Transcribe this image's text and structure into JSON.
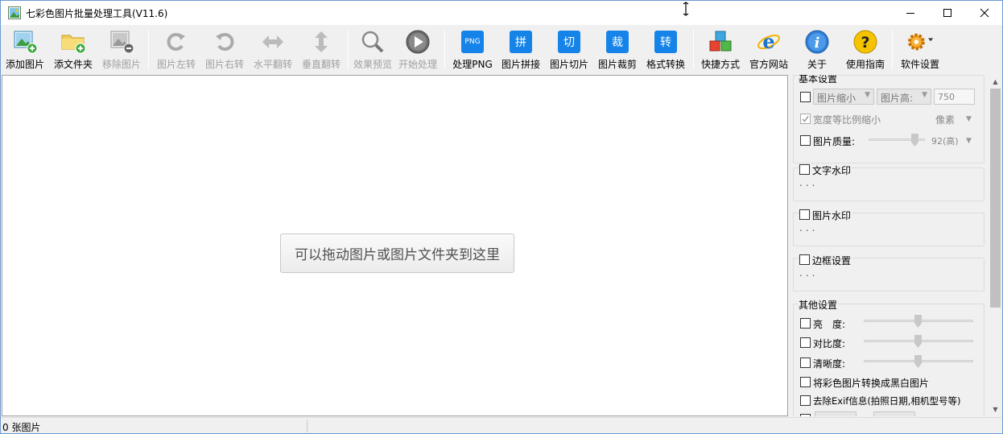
{
  "window": {
    "title": "七彩色图片批量处理工具(V11.6)"
  },
  "toolbar": {
    "items": [
      {
        "label": "添加图片",
        "icon": "add-image-icon",
        "enabled": true
      },
      {
        "label": "添文件夹",
        "icon": "add-folder-icon",
        "enabled": true
      },
      {
        "label": "移除图片",
        "icon": "remove-image-icon",
        "enabled": false
      },
      {
        "label": "图片左转",
        "icon": "rotate-left-icon",
        "enabled": false
      },
      {
        "label": "图片右转",
        "icon": "rotate-right-icon",
        "enabled": false
      },
      {
        "label": "水平翻转",
        "icon": "flip-horizontal-icon",
        "enabled": false
      },
      {
        "label": "垂直翻转",
        "icon": "flip-vertical-icon",
        "enabled": false
      },
      {
        "label": "效果预览",
        "icon": "preview-magnifier-icon",
        "enabled": false
      },
      {
        "label": "开始处理",
        "icon": "start-play-icon",
        "enabled": false
      },
      {
        "label": "处理PNG",
        "icon": "png-icon",
        "icon_text": "PNG",
        "enabled": true
      },
      {
        "label": "图片拼接",
        "icon": "stitch-icon",
        "icon_text": "拼",
        "enabled": true
      },
      {
        "label": "图片切片",
        "icon": "slice-icon",
        "icon_text": "切",
        "enabled": true
      },
      {
        "label": "图片裁剪",
        "icon": "crop-icon",
        "icon_text": "裁",
        "enabled": true
      },
      {
        "label": "格式转换",
        "icon": "convert-icon",
        "icon_text": "转",
        "enabled": true
      },
      {
        "label": "快捷方式",
        "icon": "shortcut-cubes-icon",
        "enabled": true
      },
      {
        "label": "官方网站",
        "icon": "ie-browser-icon",
        "enabled": true
      },
      {
        "label": "关于",
        "icon": "info-icon",
        "enabled": true
      },
      {
        "label": "使用指南",
        "icon": "help-icon",
        "enabled": true
      },
      {
        "label": "软件设置",
        "icon": "settings-gear-icon",
        "enabled": true
      }
    ]
  },
  "main": {
    "drop_hint": "可以拖动图片或图片文件夹到这里"
  },
  "panel": {
    "basic": {
      "title": "基本设置",
      "resize_mode": "图片缩小",
      "dimension": "图片高:",
      "dimension_value": "750",
      "keep_ratio": "宽度等比例缩小",
      "unit": "像素",
      "quality_label": "图片质量:",
      "quality_value": "92(高)"
    },
    "text_watermark": {
      "title": "文字水印",
      "dots": "..."
    },
    "image_watermark": {
      "title": "图片水印",
      "dots": "..."
    },
    "border": {
      "title": "边框设置",
      "dots": "..."
    },
    "other": {
      "title": "其他设置",
      "brightness": "亮　度:",
      "contrast": "对比度:",
      "sharpness": "清晰度:",
      "grayscale": "将彩色图片转换成黑白图片",
      "exif": "去除Exif信息(拍照日期,相机型号等)"
    }
  },
  "status": {
    "count": "0 张图片"
  }
}
